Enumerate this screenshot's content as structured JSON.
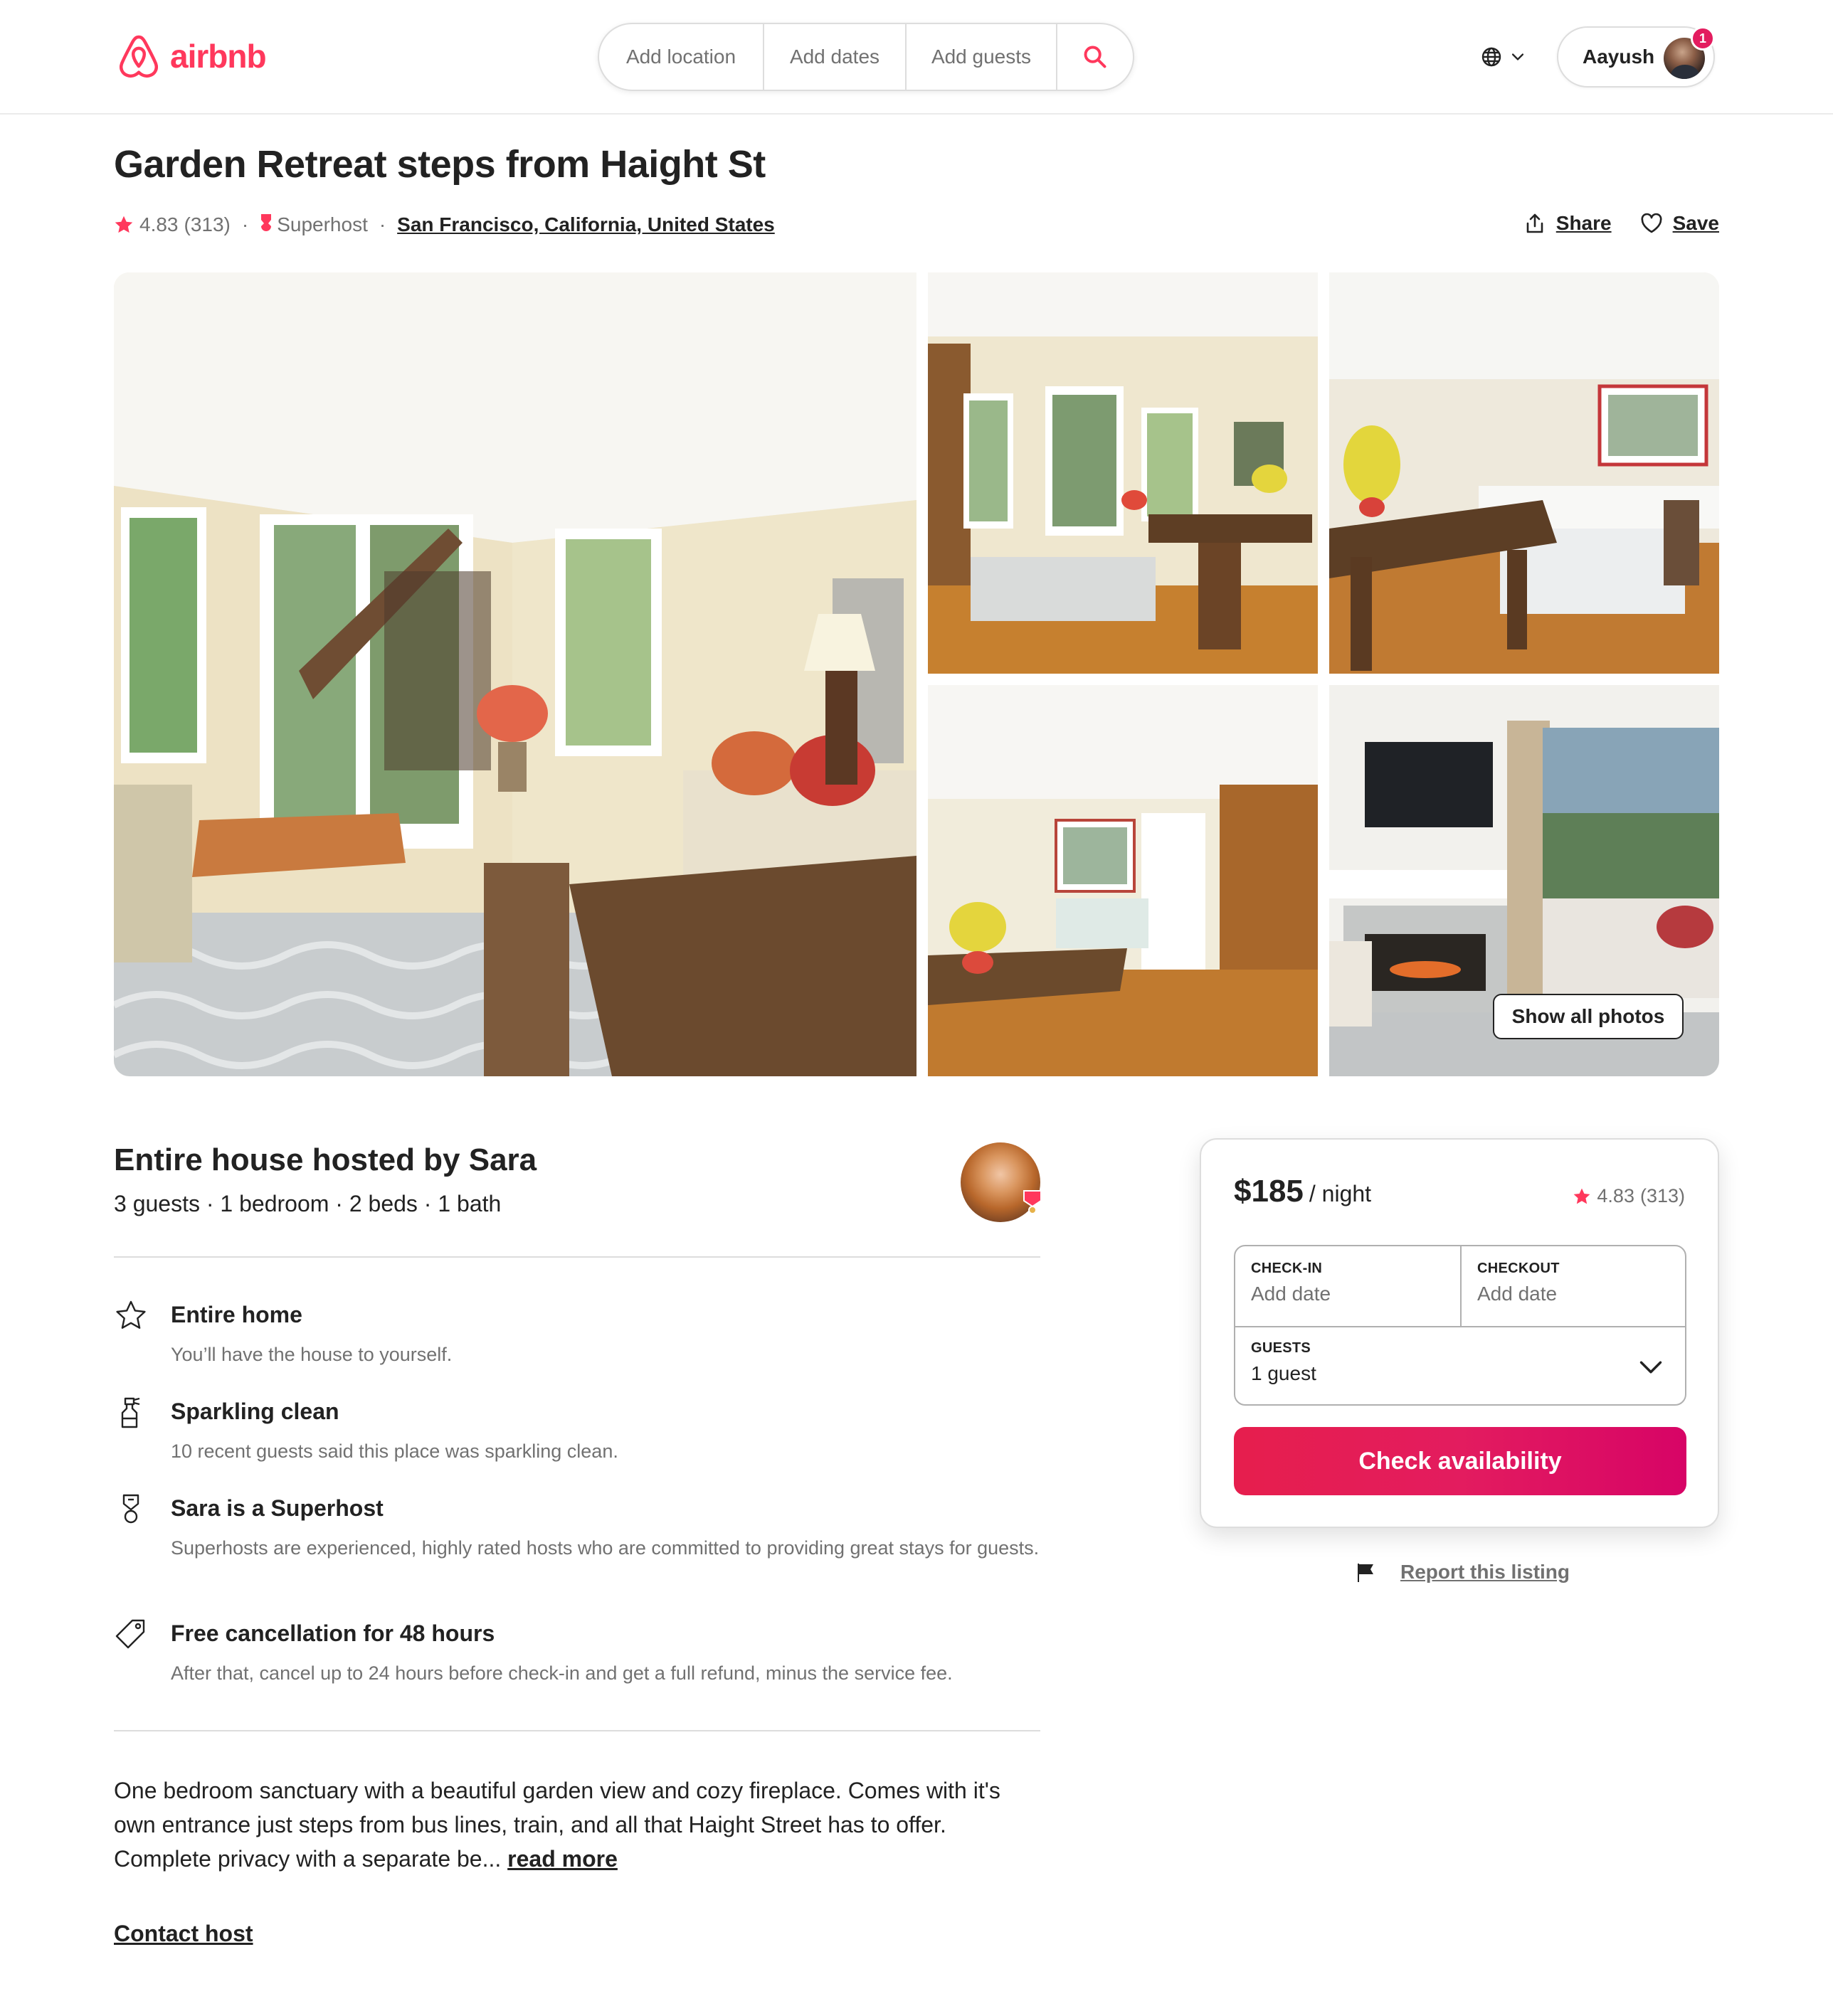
{
  "header": {
    "logo_text": "airbnb",
    "search": {
      "location_label": "Add location",
      "dates_label": "Add dates",
      "guests_label": "Add guests"
    },
    "user": {
      "name": "Aayush",
      "notification_count": "1"
    }
  },
  "listing": {
    "title": "Garden Retreat steps from Haight St",
    "rating": "4.83",
    "review_count": "(313)",
    "superhost_label": "Superhost",
    "location": "San Francisco, California, United States",
    "share_label": "Share",
    "save_label": "Save",
    "show_all_photos_label": "Show all photos"
  },
  "overview": {
    "title": "Entire house hosted by Sara",
    "subtitle": "3 guests · 1 bedroom · 2 beds · 1 bath"
  },
  "features": [
    {
      "title": "Entire home",
      "description": "You’ll have the house to yourself.",
      "icon": "home-icon"
    },
    {
      "title": "Sparkling clean",
      "description": "10 recent guests said this place was sparkling clean.",
      "icon": "spray-bottle-icon"
    },
    {
      "title": "Sara is a Superhost",
      "description": "Superhosts are experienced, highly rated hosts who are committed to providing great stays for guests.",
      "icon": "superhost-medal-icon"
    },
    {
      "title": "Free cancellation for 48 hours",
      "description": "After that, cancel up to 24 hours before check-in and get a full refund, minus the service fee.",
      "icon": "price-tag-icon"
    }
  ],
  "description": {
    "text": "One bedroom sanctuary with a beautiful garden view and cozy fireplace. Comes with it's own entrance just steps from bus lines, train, and all that Haight Street has to offer. Complete privacy with a separate be...",
    "read_more_label": "read more"
  },
  "contact_host_label": "Contact host",
  "booking": {
    "price": "$185",
    "per_night": "/ night",
    "rating": "4.83",
    "review_count": "(313)",
    "checkin_label": "CHECK-IN",
    "checkin_value": "Add date",
    "checkout_label": "CHECKOUT",
    "checkout_value": "Add date",
    "guests_label": "GUESTS",
    "guests_value": "1 guest",
    "cta_label": "Check availability"
  },
  "report_label": "Report this listing",
  "colors": {
    "brand": "#ff385c",
    "cta_start": "#e61e4d",
    "cta_end": "#d70466",
    "text_primary": "#222222",
    "text_secondary": "#717171",
    "divider": "#dddddd"
  }
}
